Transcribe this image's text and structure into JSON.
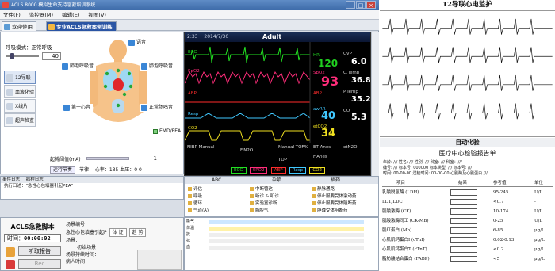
{
  "window": {
    "title": "ACLS 8000 模拟生命支持急救培训系统"
  },
  "menu": [
    "文件(F)",
    "监控器(M)",
    "编辑(E)",
    "视图(V)"
  ],
  "tabs": [
    {
      "label": "欢迎使用"
    },
    {
      "label": "专业ACLS急救案例训练"
    }
  ],
  "left": {
    "mode_label": "呼吸模式：正常呼吸",
    "mode_value": "40",
    "nav": [
      "12导联心电监护",
      "血液化验",
      "X线片",
      "超声检查"
    ],
    "body_tags": {
      "voice": "语音",
      "left_breath": "肺泡呼吸音",
      "right_breath": "肺泡呼吸音",
      "heart": "第一心音",
      "bowel": "正常肠鸣音"
    },
    "emd_label": "EMD/PEA",
    "pace_label": "起搏阈值(mA)",
    "pace_value": "1",
    "pace_buttons": [
      "运行节奏",
      "节律：",
      "心率：135",
      "血压：0",
      "0"
    ]
  },
  "monitor": {
    "time": "2:33",
    "date": "2014/7/30",
    "mode": "Adult",
    "waves": [
      "ECG",
      "SpO2",
      "ABP",
      "Resp",
      "CO2"
    ],
    "vitals": {
      "hr": {
        "label": "HR",
        "value": "120",
        "color": "#20d020"
      },
      "spo2": {
        "label": "SpO2",
        "value": "93",
        "color": "#ff2d7a"
      },
      "abp": {
        "label": "ABP",
        "value": "",
        "color": "#ff2d2d"
      },
      "awrr": {
        "label": "awRR",
        "value": "40",
        "color": "#40c8ff"
      },
      "etco2": {
        "label": "etCO2",
        "value": "34",
        "color": "#f0e020"
      },
      "cvp": {
        "label": "CVP",
        "value": "6.0",
        "color": "#ffffff"
      },
      "ctemp": {
        "label": "C.Temp",
        "value": "36.8",
        "color": "#ffffff"
      },
      "ptemp": {
        "label": "P.Temp",
        "value": "35.2",
        "color": "#ffffff"
      },
      "co": {
        "label": "CO",
        "value": "5.3",
        "color": "#ffffff"
      }
    },
    "footer": [
      "NIBP Manual",
      "FiN2O",
      "Manual TOF%",
      "ET Anes",
      "etN2O",
      "TOP",
      "FiAnes"
    ],
    "legend": [
      "ECG",
      "SPO2",
      "ABP",
      "Resp",
      "CO2"
    ]
  },
  "log": {
    "tabs": [
      "事件日志",
      "病程日志"
    ],
    "line": "执行口述：\"急性心包填塞引起PEA\""
  },
  "tools": {
    "tabs": [
      "ABC",
      "杂项",
      "插药"
    ],
    "col1": [
      "评估",
      "呼吸",
      "循环",
      "气道(A)"
    ],
    "col2": [
      "中断管这",
      "听诊 & 叩诊",
      "实验室诊断",
      "胸腔气"
    ],
    "col3": [
      "静脉通路",
      "停止服要受体激动药",
      "停止服要受体阻断药",
      "胆碱受体阻断药"
    ],
    "timeline_rows": [
      "吸气",
      "体温",
      "抚",
      "抹",
      "血"
    ]
  },
  "script": {
    "title": "ACLS急救脚本",
    "timer_label": "时间：",
    "timer_value": "00:00:02",
    "report": "听取报告",
    "run": "Rec",
    "case_label": "场景编号：",
    "case_value": "急性心包填塞引起P",
    "btn1": "体 证",
    "btn2": "趋 势",
    "scene_label": "场景：",
    "scene_value": "初始场景",
    "scene_time": "场景持续时间：",
    "patient_label": "病人时间："
  },
  "report": {
    "ecg_title": "12导联心电监护",
    "lab_title": "自动化验",
    "lab_heading": "医疗中心检验报告单",
    "meta": [
      "年龄: ///  姓名: ///  性别: ///  科室: ///  科室：/// ",
      "编号: ///  标本号: 000000  标本类型: ///  标本号: ///",
      "时间: 00-00-00  送检时间: 00-00-00  心肌酶及心肌蛋白  ///"
    ],
    "columns": [
      "项目",
      "结果",
      "参考值",
      "单位"
    ],
    "rows": [
      {
        "name": "乳酸脱氢酶 (LDH)",
        "ref": "95-245",
        "unit": "U/L"
      },
      {
        "name": "LD1/LDC",
        "ref": "<0.7",
        "unit": "-"
      },
      {
        "name": "肌酸激酶 (CK)",
        "ref": "10-174",
        "unit": "U/L"
      },
      {
        "name": "肌酸激酶同工 (CK-MB)",
        "ref": "0-25",
        "unit": "U/L"
      },
      {
        "name": "肌红蛋白 (Mb)",
        "ref": "6-85",
        "unit": "μg/L"
      },
      {
        "name": "心肌肌钙蛋白I (cTnI)",
        "ref": "0.02-0.13",
        "unit": "μg/L"
      },
      {
        "name": "心肌肌钙蛋白T (cTnT)",
        "ref": "<0.2",
        "unit": "μg/L"
      },
      {
        "name": "脂肪酸结合蛋白 (FABP)",
        "ref": "<5",
        "unit": "μg/L"
      }
    ]
  }
}
